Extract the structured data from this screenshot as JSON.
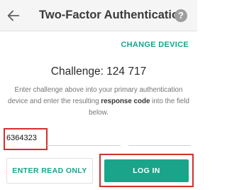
{
  "header": {
    "title": "Two-Factor Authentication",
    "back_icon": "arrow-left-icon",
    "help_icon": "help-circle-icon",
    "help_glyph": "?"
  },
  "change_device_label": "CHANGE DEVICE",
  "challenge_text": "Challenge: 124 717",
  "instructions": {
    "part1": "Enter challenge above into your primary authentication device and enter the resulting ",
    "emphasis": "response code",
    "part2": " into the field below."
  },
  "response_field": {
    "value": "6364323",
    "highlight_color": "#d32f2f"
  },
  "buttons": {
    "read_only_label": "ENTER READ ONLY",
    "login_label": "LOG IN"
  },
  "colors": {
    "accent": "#17a58a",
    "primary_button": "#1aa58a",
    "highlight": "#d32f2f"
  }
}
